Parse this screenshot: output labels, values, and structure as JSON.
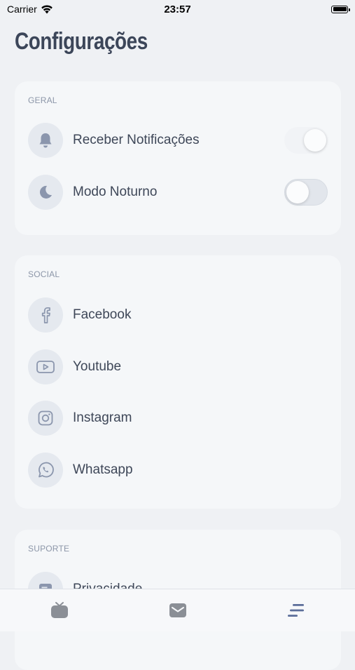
{
  "status_bar": {
    "carrier": "Carrier",
    "time": "23:57"
  },
  "page": {
    "title": "Configurações"
  },
  "sections": {
    "geral": {
      "label": "GERAL",
      "items": [
        {
          "label": "Receber Notificações",
          "icon": "bell-icon",
          "toggle": true
        },
        {
          "label": "Modo Noturno",
          "icon": "moon-icon",
          "toggle": false
        }
      ]
    },
    "social": {
      "label": "SOCIAL",
      "items": [
        {
          "label": "Facebook",
          "icon": "facebook-icon"
        },
        {
          "label": "Youtube",
          "icon": "youtube-icon"
        },
        {
          "label": "Instagram",
          "icon": "instagram-icon"
        },
        {
          "label": "Whatsapp",
          "icon": "whatsapp-icon"
        }
      ]
    },
    "suporte": {
      "label": "SUPORTE",
      "items": [
        {
          "label": "Privacidade",
          "icon": "privacy-icon"
        }
      ]
    }
  },
  "tab_bar": {
    "tabs": [
      {
        "icon": "tv-icon",
        "active": false
      },
      {
        "icon": "mail-icon",
        "active": false
      },
      {
        "icon": "menu-icon",
        "active": true
      }
    ]
  },
  "colors": {
    "icon": "#8b96ad",
    "active_tab": "#5b6d99",
    "background": "#eff1f4",
    "card": "#f5f7f9"
  }
}
